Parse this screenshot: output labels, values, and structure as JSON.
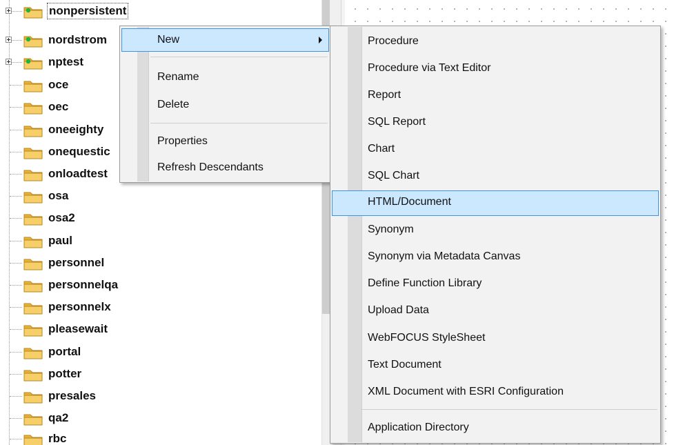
{
  "tree": {
    "items": [
      {
        "label": "nonpersistent",
        "expandable": true,
        "folder_color": "green-dot"
      },
      {
        "label": "nordstrom",
        "expandable": true,
        "folder_color": "green-dot"
      },
      {
        "label": "nptest",
        "expandable": true,
        "folder_color": "green-dot"
      },
      {
        "label": "oce",
        "expandable": false
      },
      {
        "label": "oec",
        "expandable": false
      },
      {
        "label": "oneeighty",
        "expandable": false
      },
      {
        "label": "onequestic",
        "expandable": false
      },
      {
        "label": "onloadtest",
        "expandable": false
      },
      {
        "label": "osa",
        "expandable": false
      },
      {
        "label": "osa2",
        "expandable": false
      },
      {
        "label": "paul",
        "expandable": false
      },
      {
        "label": "personnel",
        "expandable": false
      },
      {
        "label": "personnelqa",
        "expandable": false
      },
      {
        "label": "personnelx",
        "expandable": false
      },
      {
        "label": "pleasewait",
        "expandable": false
      },
      {
        "label": "portal",
        "expandable": false
      },
      {
        "label": "potter",
        "expandable": false
      },
      {
        "label": "presales",
        "expandable": false
      },
      {
        "label": "qa2",
        "expandable": false
      },
      {
        "label": "rbc",
        "expandable": false
      }
    ]
  },
  "context_menu": {
    "new_label": "New",
    "rename_label": "Rename",
    "delete_label": "Delete",
    "properties_label": "Properties",
    "refresh_label": "Refresh Descendants"
  },
  "submenu": {
    "items": [
      "Procedure",
      "Procedure via Text Editor",
      "Report",
      "SQL Report",
      "Chart",
      "SQL Chart",
      "HTML/Document",
      "Synonym",
      "Synonym via Metadata Canvas",
      "Define Function Library",
      "Upload Data",
      "WebFOCUS StyleSheet",
      "Text Document",
      "XML Document with ESRI Configuration",
      "Application Directory"
    ],
    "highlighted": "HTML/Document"
  },
  "colors": {
    "highlight_fill": "#cce8ff",
    "highlight_border": "#3d93dd",
    "menu_bg": "#f2f2f2",
    "folder": "#e8b23a",
    "status_dot": "#1fb53a"
  }
}
